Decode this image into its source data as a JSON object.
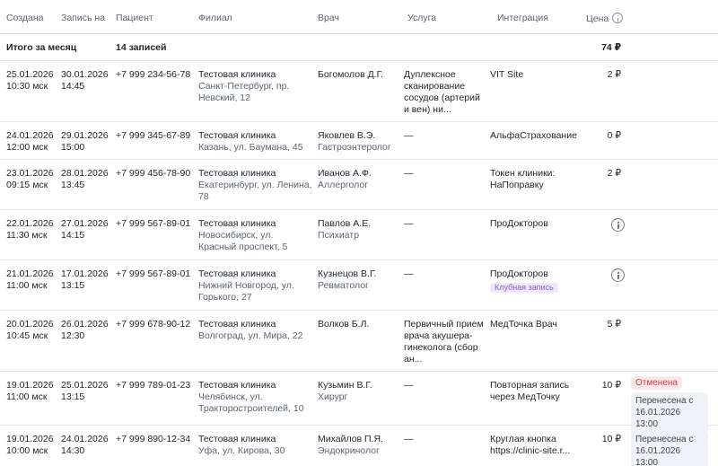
{
  "columns": {
    "created": "Создана",
    "booked_for": "Запись на",
    "patient": "Пациент",
    "branch": "Филиал",
    "doctor": "Врач",
    "service": "Услуга",
    "integration": "Интеграция",
    "price": "Цена"
  },
  "total": {
    "label": "Итого за месяц",
    "count": "14 записей",
    "sum": "74 ₽"
  },
  "rows": [
    {
      "created_date": "25.01.2026",
      "created_time": "10:30 мск",
      "booked_date": "30.01.2026",
      "booked_time": "14:45",
      "phone": "+7 999 234-56-78",
      "clinic": "Тестовая клиника",
      "address": "Санкт-Петербург, пр. Невский, 12",
      "doctor": "Богомолов Д.Г.",
      "specialty": "",
      "service": "Дуплексное сканирование сосудов (артерий и вен) ни...",
      "integration": "VIT Site",
      "price": "2 ₽"
    },
    {
      "created_date": "24.01.2026",
      "created_time": "12:00 мск",
      "booked_date": "29.01.2026",
      "booked_time": "15:00",
      "phone": "+7 999 345-67-89",
      "clinic": "Тестовая клиника",
      "address": "Казань, ул. Баумана, 45",
      "doctor": "Яковлев В.Э.",
      "specialty": "Гастроэнтеролог",
      "service": "—",
      "integration": "АльфаСтрахование",
      "price": "0 ₽"
    },
    {
      "created_date": "23.01.2026",
      "created_time": "09:15 мск",
      "booked_date": "28.01.2026",
      "booked_time": "13:45",
      "phone": "+7 999 456-78-90",
      "clinic": "Тестовая клиника",
      "address": "Екатеринбург, ул. Ленина, 78",
      "doctor": "Иванов А.Ф.",
      "specialty": "Аллерголог",
      "service": "—",
      "integration": "Токен клиники: НаПоправку",
      "price": "2 ₽"
    },
    {
      "created_date": "22.01.2026",
      "created_time": "11:30 мск",
      "booked_date": "27.01.2026",
      "booked_time": "14:15",
      "phone": "+7 999 567-89-01",
      "clinic": "Тестовая клиника",
      "address": "Новосибирск, ул. Красный проспект, 5",
      "doctor": "Павлов А.Е.",
      "specialty": "Психиатр",
      "service": "—",
      "integration": "ПроДокторов",
      "price": ""
    },
    {
      "created_date": "21.01.2026",
      "created_time": "11:00 мск",
      "booked_date": "17.01.2026",
      "booked_time": "13:15",
      "phone": "+7 999 567-89-01",
      "clinic": "Тестовая клиника",
      "address": "Нижний Новгород, ул. Горького, 27",
      "doctor": "Кузнецов В.Г.",
      "specialty": "Ревматолог",
      "service": "—",
      "integration": "ПроДокторов",
      "badge": "Клубная запись",
      "price": ""
    },
    {
      "created_date": "20.01.2026",
      "created_time": "10:45 мск",
      "booked_date": "26.01.2026",
      "booked_time": "12:30",
      "phone": "+7 999 678-90-12",
      "clinic": "Тестовая клиника",
      "address": "Волгоград, ул. Мира, 22",
      "doctor": "Волков Б.Л.",
      "specialty": "",
      "service": "Первичный прием врача акушера-гинеколога (сбор ан...",
      "integration": "МедТочка Врач",
      "price": "5 ₽"
    },
    {
      "created_date": "19.01.2026",
      "created_time": "11:00 мск",
      "booked_date": "25.01.2026",
      "booked_time": "13:15",
      "phone": "+7 999 789-01-23",
      "clinic": "Тестовая клиника",
      "address": "Челябинск, ул. Тракторостроителей, 10",
      "doctor": "Кузьмин В.Г.",
      "specialty": "Хирург",
      "service": "—",
      "integration": "Повторная запись через МедТочку",
      "price": "10 ₽",
      "status": "Отменена",
      "moved": "Перенесена с 16.01.2026 13:00"
    },
    {
      "created_date": "19.01.2026",
      "created_time": "10:00 мск",
      "booked_date": "24.01.2026",
      "booked_time": "14:30",
      "phone": "+7 999 890-12-34",
      "clinic": "Тестовая клиника",
      "address": "Уфа, ул. Кирова, 30",
      "doctor": "Михайлов П.Я.",
      "specialty": "Эндокринолог",
      "service": "—",
      "integration": "Круглая кнопка https://clinic-site.r...",
      "price": "10 ₽",
      "moved": "Перенесена с 16.01.2026 13:00"
    }
  ]
}
